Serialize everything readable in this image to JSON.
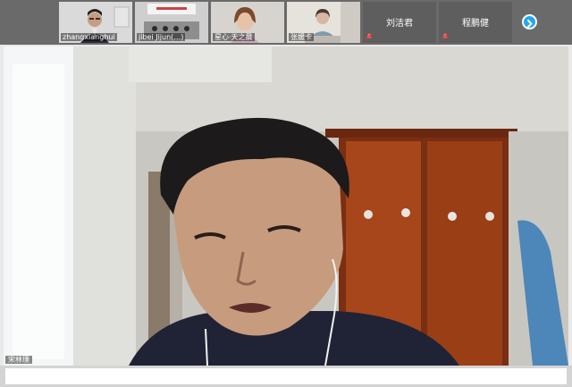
{
  "participants": [
    {
      "caption": "zhangxianghui",
      "type": "video"
    },
    {
      "caption": "jibei Jijun(…)",
      "type": "video"
    },
    {
      "caption": "星心·天之晨",
      "type": "video"
    },
    {
      "caption": "张媛卡",
      "type": "video"
    },
    {
      "name": "刘洁君",
      "type": "audio",
      "mic": "muted"
    },
    {
      "name": "程鹏健",
      "type": "audio",
      "mic": "muted"
    }
  ],
  "nav": {
    "next_icon": "chevron-right-icon"
  },
  "main_video": {
    "caption": "宋林璞"
  }
}
